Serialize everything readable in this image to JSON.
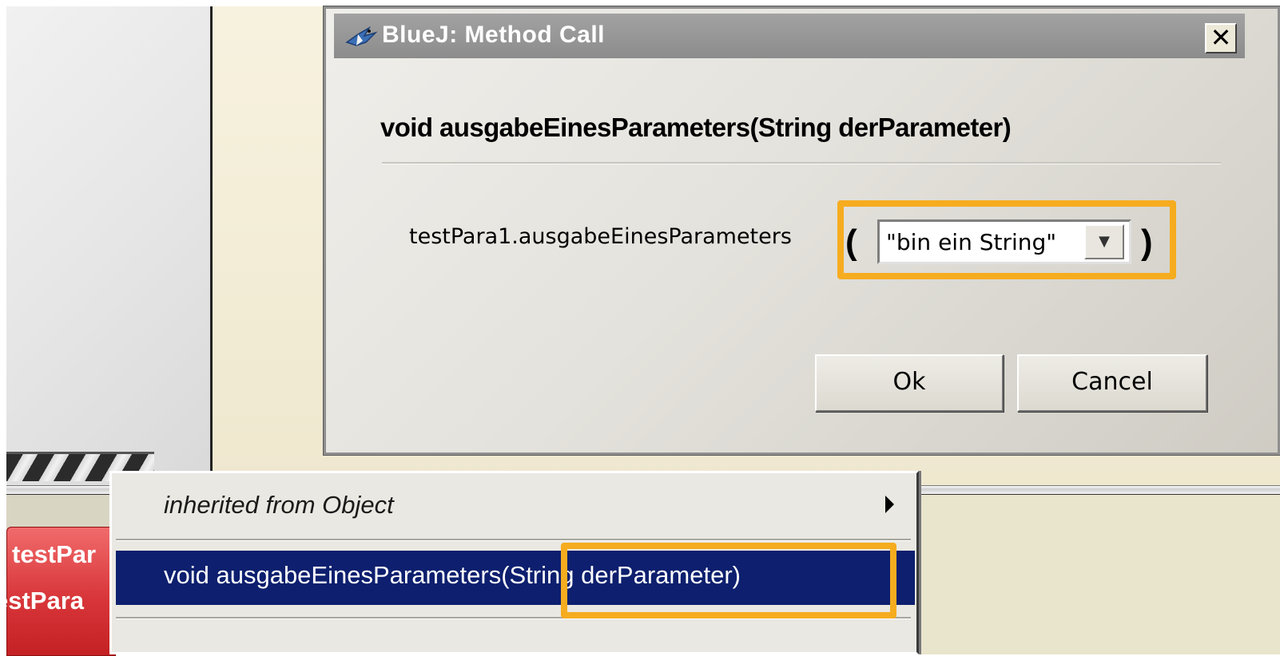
{
  "dialog": {
    "title": "BlueJ:  Method Call",
    "close_glyph": "✕",
    "signature": "void ausgabeEinesParameters(String derParameter)",
    "call_prefix": "testPara1.ausgabeEinesParameters",
    "open_paren": "(",
    "close_paren": ")",
    "param_value": "\"bin ein String\"",
    "ok_label": "Ok",
    "cancel_label": "Cancel"
  },
  "object_bench": {
    "label_line1": "testPar",
    "label_line2": "estPara"
  },
  "context_menu": {
    "items": [
      {
        "label": "inherited from Object",
        "submenu": true
      },
      {
        "label": "void ausgabeEinesParameters(String derParameter)",
        "selected": true
      }
    ]
  },
  "colors": {
    "highlight_outline": "#f6ac1f",
    "menu_selection": "#0d1f6e",
    "object_red": "#d8363a",
    "title_bar": "#8c8c8c"
  },
  "icons": {
    "title": "bluej-bird-icon",
    "close": "close-icon",
    "combo": "chevron-down-icon",
    "submenu": "submenu-arrow-icon"
  }
}
